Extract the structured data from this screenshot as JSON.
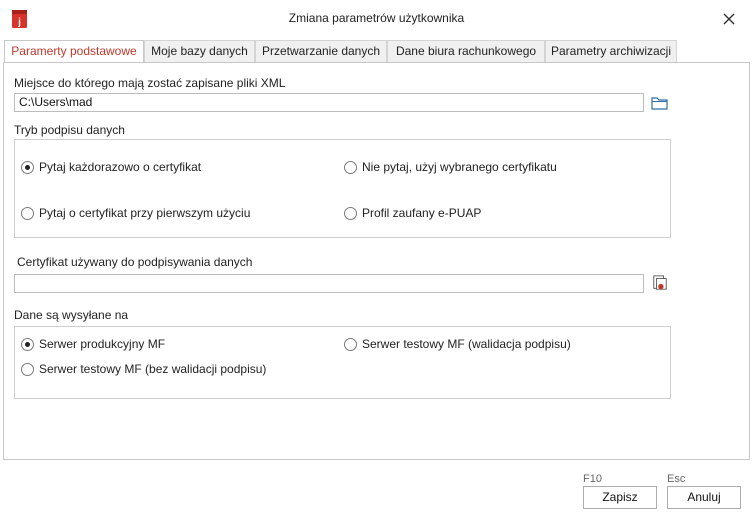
{
  "window": {
    "title": "Zmiana parametrów użytkownika",
    "icon": "app-icon",
    "accent": "#c0392b"
  },
  "tabs": [
    {
      "label": "Paramerty podstawowe",
      "active": true
    },
    {
      "label": "Moje bazy danych",
      "active": false
    },
    {
      "label": "Przetwarzanie danych",
      "active": false
    },
    {
      "label": "Dane biura rachunkowego",
      "active": false
    },
    {
      "label": "Parametry archiwizacji",
      "active": false
    }
  ],
  "xml_location": {
    "label": "Miejsce do którego mają zostać zapisane pliki XML",
    "value": "C:\\Users\\mad",
    "browse_icon": "folder-icon"
  },
  "signature_mode": {
    "label": "Tryb podpisu danych",
    "options": [
      {
        "label": "Pytaj każdorazowo o certyfikat",
        "checked": true
      },
      {
        "label": "Nie pytaj, użyj wybranego certyfikatu",
        "checked": false
      },
      {
        "label": "Pytaj o certyfikat przy pierwszym użyciu",
        "checked": false
      },
      {
        "label": "Profil zaufany e-PUAP",
        "checked": false
      }
    ]
  },
  "certificate": {
    "label": "Certyfikat używany do podpisywania danych",
    "value": "",
    "select_icon": "certificate-icon"
  },
  "send_target": {
    "label": "Dane są wysyłane na",
    "options": [
      {
        "label": "Serwer produkcyjny MF",
        "checked": true
      },
      {
        "label": "Serwer testowy MF (walidacja podpisu)",
        "checked": false
      },
      {
        "label": "Serwer testowy MF (bez walidacji podpisu)",
        "checked": false
      }
    ]
  },
  "footer": {
    "save": {
      "shortcut": "F10",
      "label": "Zapisz"
    },
    "cancel": {
      "shortcut": "Esc",
      "label": "Anuluj"
    }
  }
}
